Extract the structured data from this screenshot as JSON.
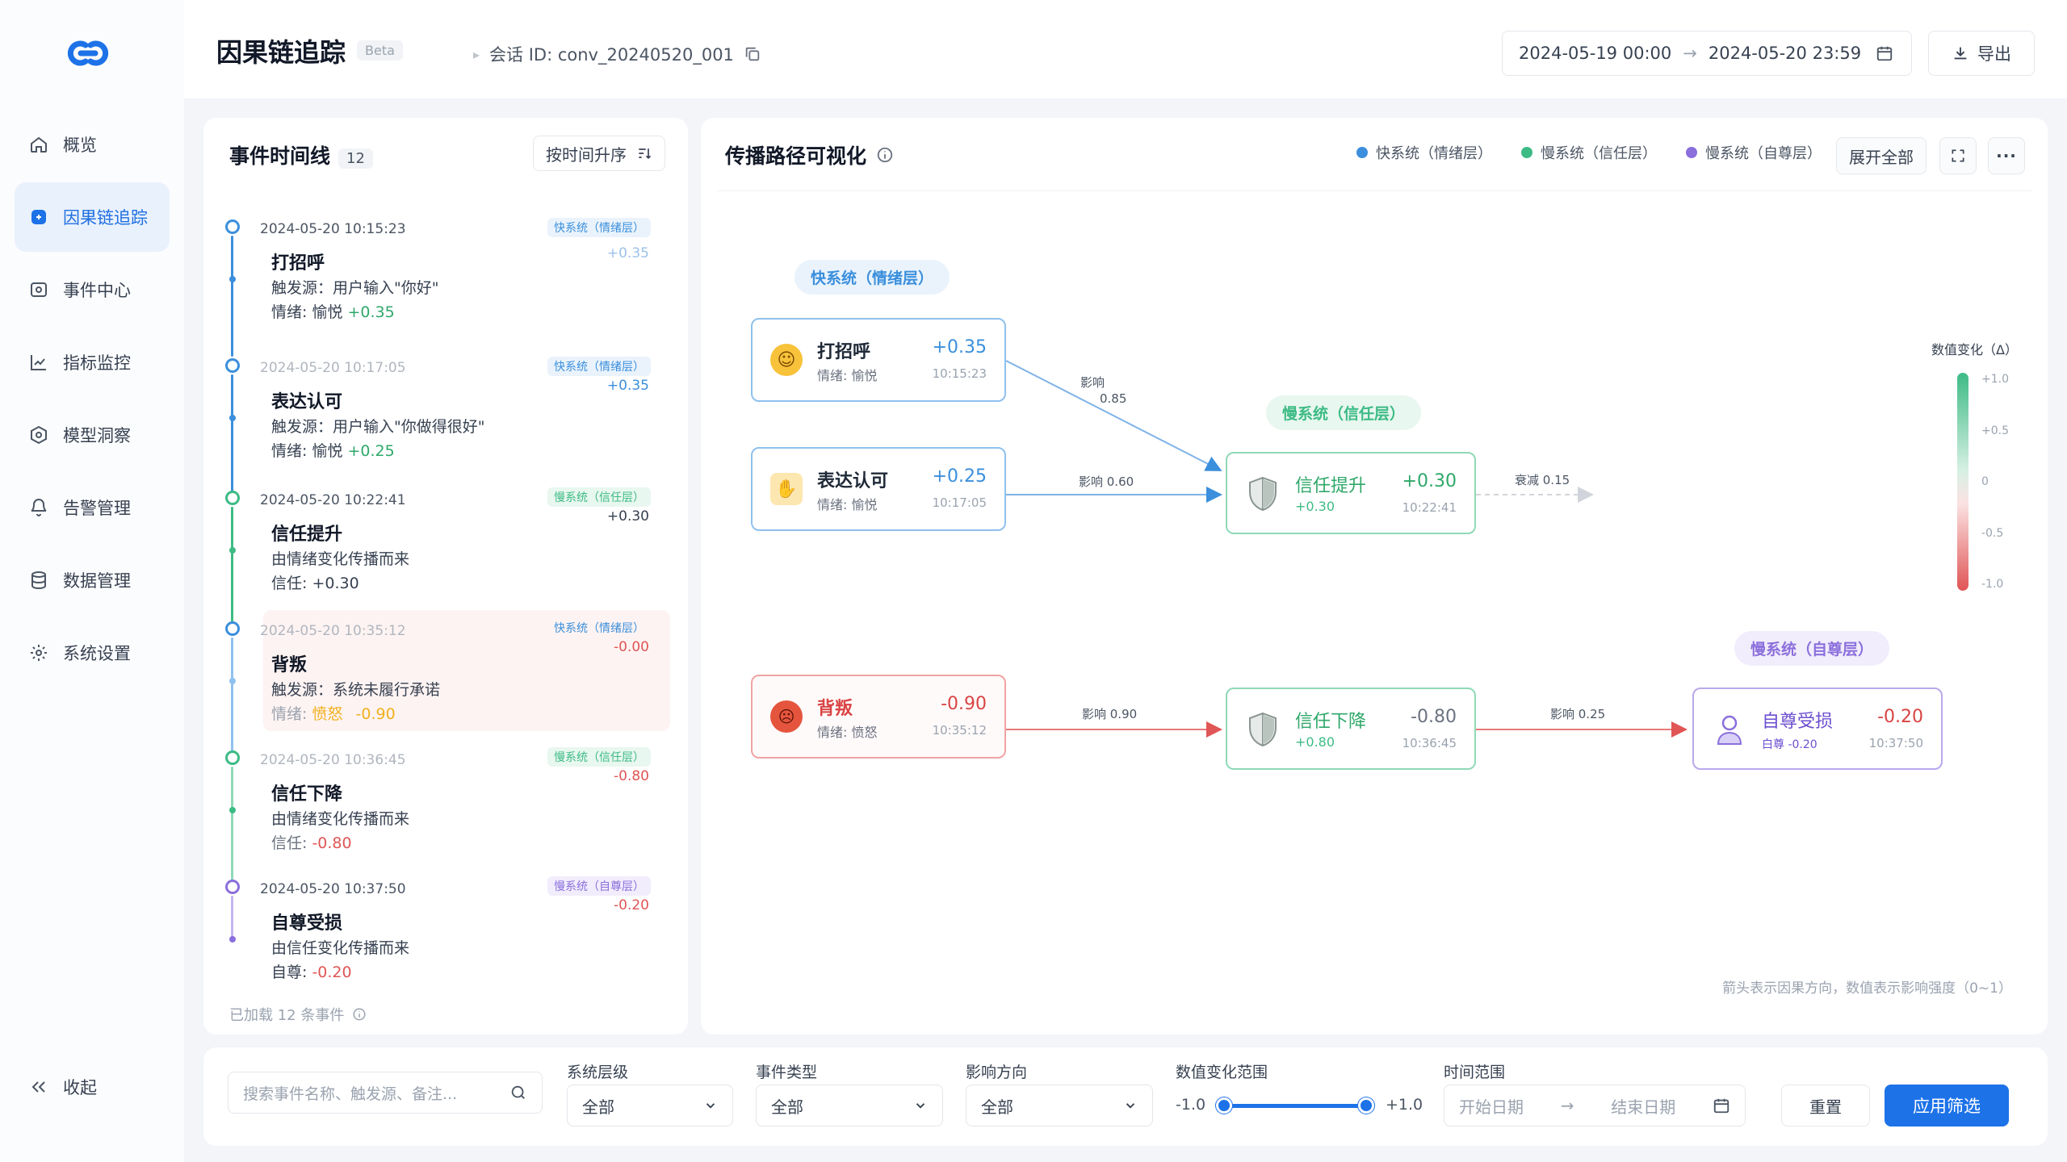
{
  "app": {
    "title": "因果链追踪",
    "beta": "Beta",
    "conv_label": "会话 ID: conv_20240520_001"
  },
  "colors": {
    "accent": "#1d72e8",
    "fast": "#3b8fdc",
    "trust": "#3dbb85",
    "esteem": "#8b6fdc",
    "negative": "#e05555",
    "positive": "#2fa86a",
    "anger": "#f2b01e"
  },
  "sidebar": {
    "items": [
      {
        "label": "概览",
        "icon": "home-icon"
      },
      {
        "label": "因果链追踪",
        "icon": "link-icon",
        "active": true
      },
      {
        "label": "事件中心",
        "icon": "events-icon"
      },
      {
        "label": "指标监控",
        "icon": "chart-icon"
      },
      {
        "label": "模型洞察",
        "icon": "model-icon"
      },
      {
        "label": "告警管理",
        "icon": "bell-icon"
      },
      {
        "label": "数据管理",
        "icon": "database-icon"
      },
      {
        "label": "系统设置",
        "icon": "gear-icon"
      }
    ],
    "collapse_label": "收起"
  },
  "header": {
    "date_start": "2024-05-19 00:00",
    "date_end": "2024-05-20 23:59",
    "export_label": "导出"
  },
  "timeline": {
    "title": "事件时间线",
    "count": "12",
    "sort_label": "按时间升序",
    "footer": "已加载 12 条事件",
    "events": [
      {
        "time": "2024-05-20 10:15:23",
        "title": "打招呼",
        "line1": "触发源：用户输入\"你好\"",
        "line2_label": "情绪: 愉悦",
        "line2_value": "+0.35",
        "tag": "快系统（情绪层）",
        "delta": "+0.35"
      },
      {
        "time": "2024-05-20 10:17:05",
        "title": "表达认可",
        "line1": "触发源：用户输入\"你做得很好\"",
        "line2_label": "情绪: 愉悦",
        "line2_value": "+0.25",
        "tag": "快系统（情绪层）",
        "delta": "+0.35"
      },
      {
        "time": "2024-05-20 10:22:41",
        "title": "信任提升",
        "line1": "由情绪变化传播而来",
        "line2_label": "信任: ",
        "line2_value": "+0.30",
        "tag": "慢系统（信任层）",
        "delta": "+0.30"
      },
      {
        "time": "2024-05-20 10:35:12",
        "title": "背叛",
        "line1": "触发源：系统未履行承诺",
        "line2_label": "情绪: ",
        "line2_mood": "愤怒",
        "line2_value": "-0.90",
        "tag": "快系统（情绪层）",
        "delta": "-0.00"
      },
      {
        "time": "2024-05-20 10:36:45",
        "title": "信任下降",
        "line1": "由情绪变化传播而来",
        "line2_label": "信任: ",
        "line2_value": "-0.80",
        "tag": "慢系统（信任层）",
        "delta": "-0.80"
      },
      {
        "time": "2024-05-20 10:37:50",
        "title": "自尊受损",
        "line1": "由信任变化传播而来",
        "line2_label": "自尊: ",
        "line2_value": "-0.20",
        "tag": "慢系统（自尊层）",
        "delta": "-0.20"
      }
    ]
  },
  "canvas": {
    "title": "传播路径可视化",
    "legend": [
      "快系统（情绪层）",
      "慢系统（信任层）",
      "慢系统（自尊层）"
    ],
    "expand_label": "展开全部",
    "layers": {
      "fast": "快系统（情绪层）",
      "trust": "慢系统（信任层）",
      "esteem": "慢系统（自尊层）"
    },
    "nodes": {
      "greet": {
        "title": "打招呼",
        "sub": "情绪: 愉悦",
        "value": "+0.35",
        "time": "10:15:23"
      },
      "praise": {
        "title": "表达认可",
        "sub": "情绪: 愉悦",
        "value": "+0.25",
        "time": "10:17:05"
      },
      "trust_up": {
        "title": "信任提升",
        "sub": "+0.30",
        "value": "+0.30",
        "time": "10:22:41"
      },
      "betray": {
        "title": "背叛",
        "sub": "情绪: 愤怒",
        "value": "-0.90",
        "time": "10:35:12"
      },
      "trust_down": {
        "title": "信任下降",
        "sub": "+0.80",
        "value": "-0.80",
        "time": "10:36:45"
      },
      "esteem": {
        "title": "自尊受损",
        "sub": "白尊 -0.20",
        "value": "-0.20",
        "time": "10:37:50"
      }
    },
    "edges": {
      "greet": "影响",
      "greet_val": "0.85",
      "praise": "影响 0.60",
      "decay": "衰减 0.15",
      "betray": "影响 0.90",
      "trust_down": "影响 0.25"
    },
    "scale": {
      "title": "数值变化（Δ）",
      "ticks": [
        "+1.0",
        "+0.5",
        "0",
        "-0.5",
        "-1.0"
      ]
    },
    "note": "箭头表示因果方向，数值表示影响强度（0~1）"
  },
  "filters": {
    "search_placeholder": "搜索事件名称、触发源、备注...",
    "layer_label": "系统层级",
    "layer_value": "全部",
    "type_label": "事件类型",
    "type_value": "全部",
    "dir_label": "影响方向",
    "dir_value": "全部",
    "range_label": "数值变化范围",
    "range_min": "-1.0",
    "range_max": "+1.0",
    "time_label": "时间范围",
    "time_start": "开始日期",
    "time_end": "结束日期",
    "reset_label": "重置",
    "apply_label": "应用筛选"
  }
}
